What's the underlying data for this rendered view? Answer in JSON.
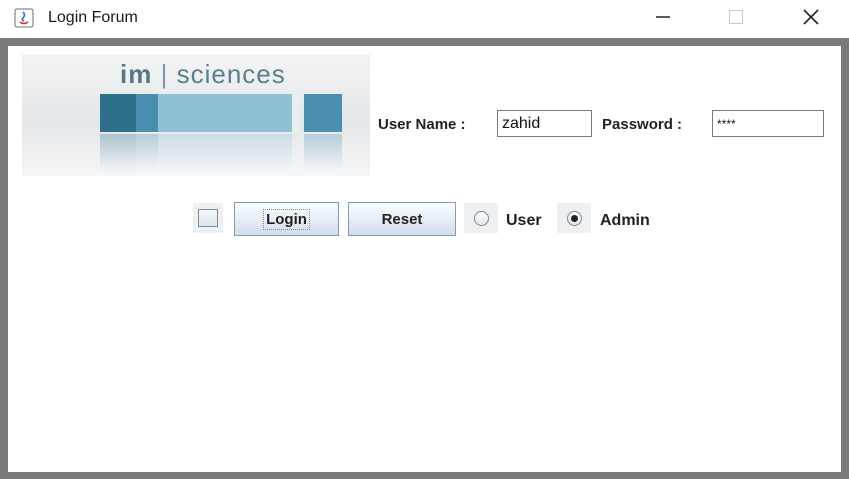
{
  "window": {
    "title": "Login Forum",
    "controls": {
      "minimize": "minimize-icon",
      "maximize": "maximize-icon",
      "close": "close-icon"
    }
  },
  "logo": {
    "brand_im": "im",
    "separator": "|",
    "brand_rest": "sciences"
  },
  "form": {
    "username_label": "User Name :",
    "username_value": "zahid",
    "password_label": "Password :",
    "password_value": "****"
  },
  "actions": {
    "remember_checked": false,
    "login_label": "Login",
    "reset_label": "Reset"
  },
  "role": {
    "options": [
      {
        "label": "User",
        "selected": false
      },
      {
        "label": "Admin",
        "selected": true
      }
    ]
  },
  "colors": {
    "logo_accent": "#4a8fb0",
    "logo_dark": "#2e6f8c",
    "button_border": "#7f9db9"
  }
}
